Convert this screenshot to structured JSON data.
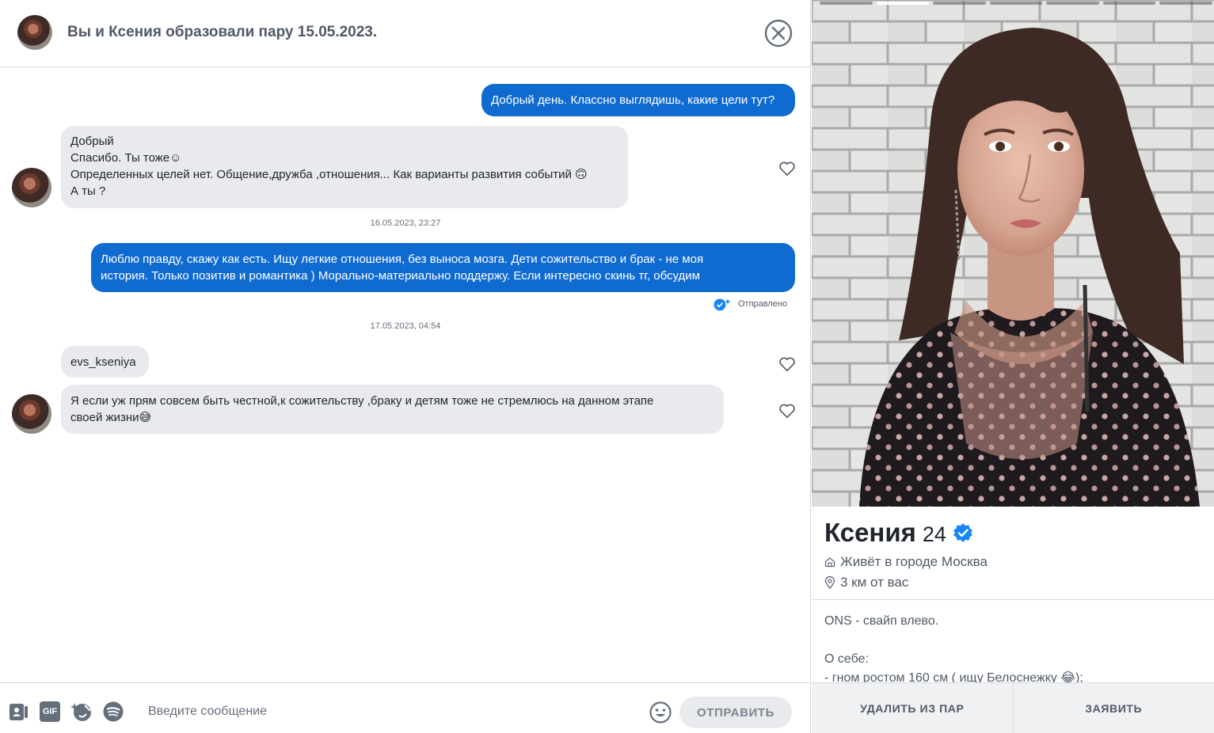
{
  "header": {
    "title": "Вы и Ксения образовали пару 15.05.2023."
  },
  "messages": {
    "m1": {
      "lines": [
        "Добрый день. Классно выглядишь, какие цели тут?"
      ]
    },
    "m2": {
      "lines": [
        "Добрый",
        "Спасибо. Ты тоже☺",
        "Определенных целей нет. Общение,дружба ,отношения... Как варианты развития событий 🙃",
        "А ты ?"
      ]
    },
    "stamp1": "16.05.2023, 23:27",
    "m3": {
      "lines": [
        "Люблю правду, скажу как есть. Ищу легкие отношения, без выноса мозга. Дети сожительство и брак - не моя",
        "история. Только позитив и романтика ) Морально-материально поддержу. Если интересно скинь тг, обсудим"
      ]
    },
    "delivered": "Отправлено",
    "stamp2": "17.05.2023, 04:54",
    "m4": {
      "lines": [
        "evs_kseniya"
      ]
    },
    "m5": {
      "lines": [
        "Я если уж прям совсем быть честной,к сожительству ,браку и детям тоже не стремлюсь на данном этапе",
        "своей жизни😅"
      ]
    }
  },
  "composer": {
    "placeholder": "Введите сообщение",
    "send_label": "ОТПРАВИТЬ",
    "icons": [
      "contact-card-icon",
      "gif-icon",
      "sticker-icon",
      "spotify-icon",
      "emoji-icon"
    ],
    "gif_label": "GIF"
  },
  "profile": {
    "photo_count": 7,
    "active_photo": 2,
    "name": "Ксения",
    "age": "24",
    "city": "Живёт в городе Москва",
    "distance": "3 км от вас",
    "bio": [
      "ONS - свайп влево.",
      "",
      "О себе:",
      "- гном ростом 160 см ( ищу Белоснежку 😂);"
    ],
    "remove_label": "УДАЛИТЬ ИЗ ПАР",
    "report_label": "ЗАЯВИТЬ"
  },
  "colors": {
    "accent": "#106bd1",
    "incoming_bubble": "#e9eaee",
    "verified": "#1786f8"
  }
}
